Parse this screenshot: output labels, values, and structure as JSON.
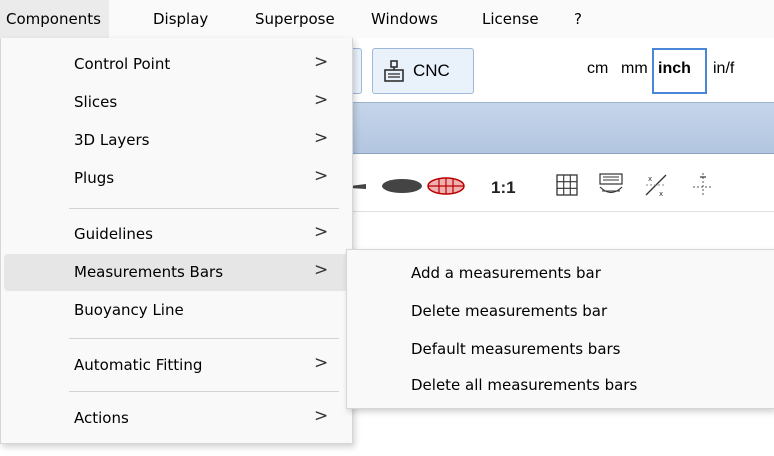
{
  "menubar": {
    "items": [
      {
        "label": "Components"
      },
      {
        "label": "Display"
      },
      {
        "label": "Superpose"
      },
      {
        "label": "Windows"
      },
      {
        "label": "License"
      },
      {
        "label": "?"
      }
    ],
    "active": "Components"
  },
  "toolbar": {
    "cnc_label": "CNC",
    "units": [
      "cm",
      "mm",
      "inch",
      "in/f"
    ],
    "selected_unit": "inch",
    "scale_label": "1:1"
  },
  "dropdown": {
    "items": [
      {
        "label": "Control Point",
        "arrow": ">"
      },
      {
        "label": "Slices",
        "arrow": ">"
      },
      {
        "label": "3D Layers",
        "arrow": ">"
      },
      {
        "label": "Plugs",
        "arrow": ">"
      },
      {
        "label": "Guidelines",
        "arrow": ">"
      },
      {
        "label": "Measurements Bars",
        "arrow": ">"
      },
      {
        "label": "Buoyancy Line",
        "arrow": ""
      },
      {
        "label": "Automatic Fitting",
        "arrow": ">"
      },
      {
        "label": "Actions",
        "arrow": ">"
      }
    ],
    "highlighted": "Measurements Bars"
  },
  "submenu": {
    "items": [
      {
        "label": "Add a measurements bar"
      },
      {
        "label": "Delete measurements bar"
      },
      {
        "label": "Default measurements bars"
      },
      {
        "label": "Delete all measurements bars"
      }
    ]
  }
}
